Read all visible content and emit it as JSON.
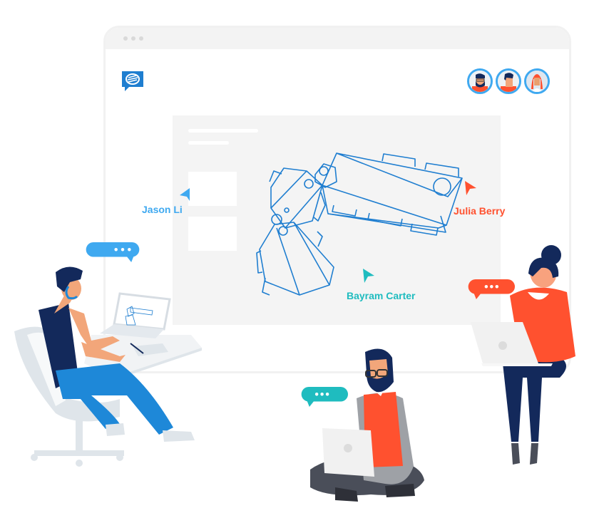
{
  "app": {
    "logo_icon": "chat-bubble-logo-icon",
    "window_controls": [
      "dot",
      "dot",
      "dot"
    ]
  },
  "collaborators": [
    {
      "name": "Avatar bearded man with glasses",
      "icon": "avatar-bearded-man"
    },
    {
      "name": "Avatar man",
      "icon": "avatar-man"
    },
    {
      "name": "Avatar woman red hair",
      "icon": "avatar-woman"
    }
  ],
  "cursors": [
    {
      "label": "Jason Li",
      "color": "#3fa9f0"
    },
    {
      "label": "Julia Berry",
      "color": "#ff512f"
    },
    {
      "label": "Bayram Carter",
      "color": "#1fbcbf"
    }
  ],
  "chat_bubbles": [
    {
      "text": "•••",
      "color": "#3fa9f0",
      "owner": "Jason Li"
    },
    {
      "text": "•••",
      "color": "#ff512f",
      "owner": "Julia Berry"
    },
    {
      "text": "•••",
      "color": "#1fbcbf",
      "owner": "Bayram Carter"
    }
  ],
  "colors": {
    "drawing_stroke": "#1f7ed0",
    "accent_blue": "#3fa9f0",
    "accent_red": "#ff512f",
    "accent_teal": "#1fbcbf",
    "navy": "#13295b"
  }
}
